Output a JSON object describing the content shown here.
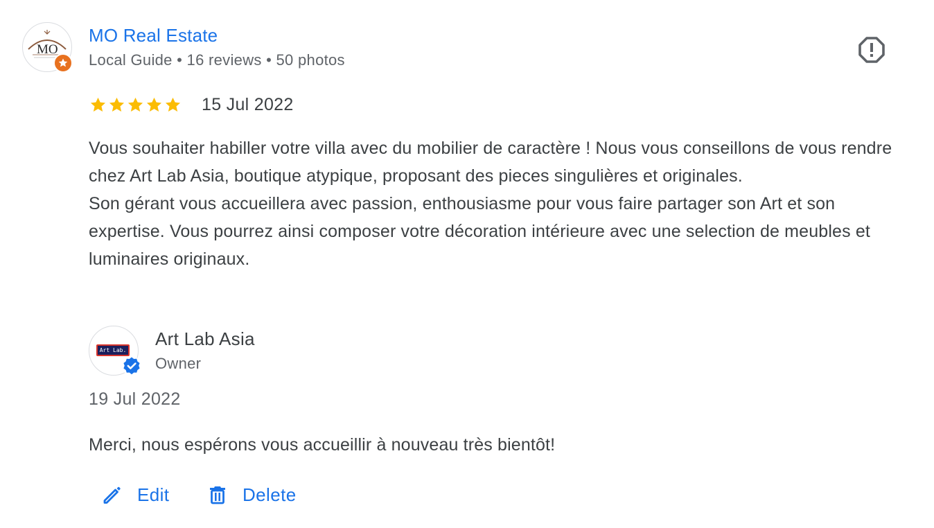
{
  "reviewer": {
    "name": "MO Real Estate",
    "avatar_text": "MO",
    "meta": "Local Guide • 16 reviews • 50 photos"
  },
  "review": {
    "rating": 5,
    "rating_max": 5,
    "date": "15 Jul 2022",
    "paragraphs": [
      "Vous souhaiter habiller votre villa avec du mobilier de caractère ! Nous vous conseillons de vous rendre chez Art Lab Asia, boutique atypique, proposant des pieces singulières et originales.",
      "Son gérant vous accueillera avec passion, enthousiasme pour vous faire partager son Art et son expertise. Vous pourrez ainsi composer votre décoration intérieure avec une selection de meubles et luminaires originaux."
    ]
  },
  "owner_response": {
    "name": "Art Lab Asia",
    "role": "Owner",
    "logo_text": "Art Lab.",
    "date": "19 Jul 2022",
    "text": "Merci, nous espérons vous accueillir à nouveau très bientôt!"
  },
  "actions": {
    "edit_label": "Edit",
    "delete_label": "Delete"
  },
  "icons": {
    "report": "report-octagon-icon",
    "star": "star-icon",
    "local_guide_badge": "local-guide-star-icon",
    "verified": "verified-check-icon",
    "edit": "pencil-icon",
    "delete": "trash-icon"
  },
  "colors": {
    "link_blue": "#1a73e8",
    "star_gold": "#fbbc04",
    "text": "#3c4043",
    "secondary_text": "#5f6368",
    "guide_badge": "#e8711f"
  }
}
